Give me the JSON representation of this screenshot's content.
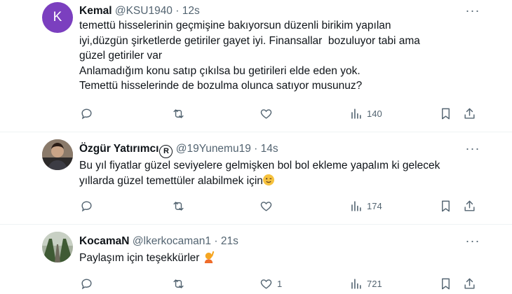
{
  "tweets": [
    {
      "avatar_letter": "K",
      "name": "Kemal",
      "handle": "@KSU1940",
      "sep": "·",
      "time": "12s",
      "lines": [
        "temettü hisselerinin geçmişine bakıyorsun düzenli birikim yapılan",
        "iyi,düzgün şirketlerde getiriler gayet iyi. Finansallar  bozuluyor tabi ama",
        "güzel getiriler var",
        "Anlamadığım konu satıp çıkılsa bu getirileri elde eden yok.",
        "Temettü hisselerinde de bozulma olunca satıyor musunuz?"
      ],
      "views": "140",
      "likes": ""
    },
    {
      "name": "Özgür Yatırımcı",
      "name_symbol": "R",
      "handle": "@19Yunemu19",
      "sep": "·",
      "time": "14s",
      "lines": [
        "Bu yıl fiyatlar güzel seviyelere gelmişken bol bol ekleme yapalım ki gelecek",
        "yıllarda güzel temettüler alabilmek için"
      ],
      "views": "174",
      "likes": ""
    },
    {
      "name": "KocamaN",
      "handle": "@lkerkocaman1",
      "sep": "·",
      "time": "21s",
      "lines": [
        "Paylaşım için teşekkürler"
      ],
      "views": "721",
      "likes": "1"
    }
  ],
  "more_label": "···",
  "colors": {
    "accent": "#536471",
    "avatar_purple": "#7b3fbf",
    "divider": "#eff3f4"
  }
}
